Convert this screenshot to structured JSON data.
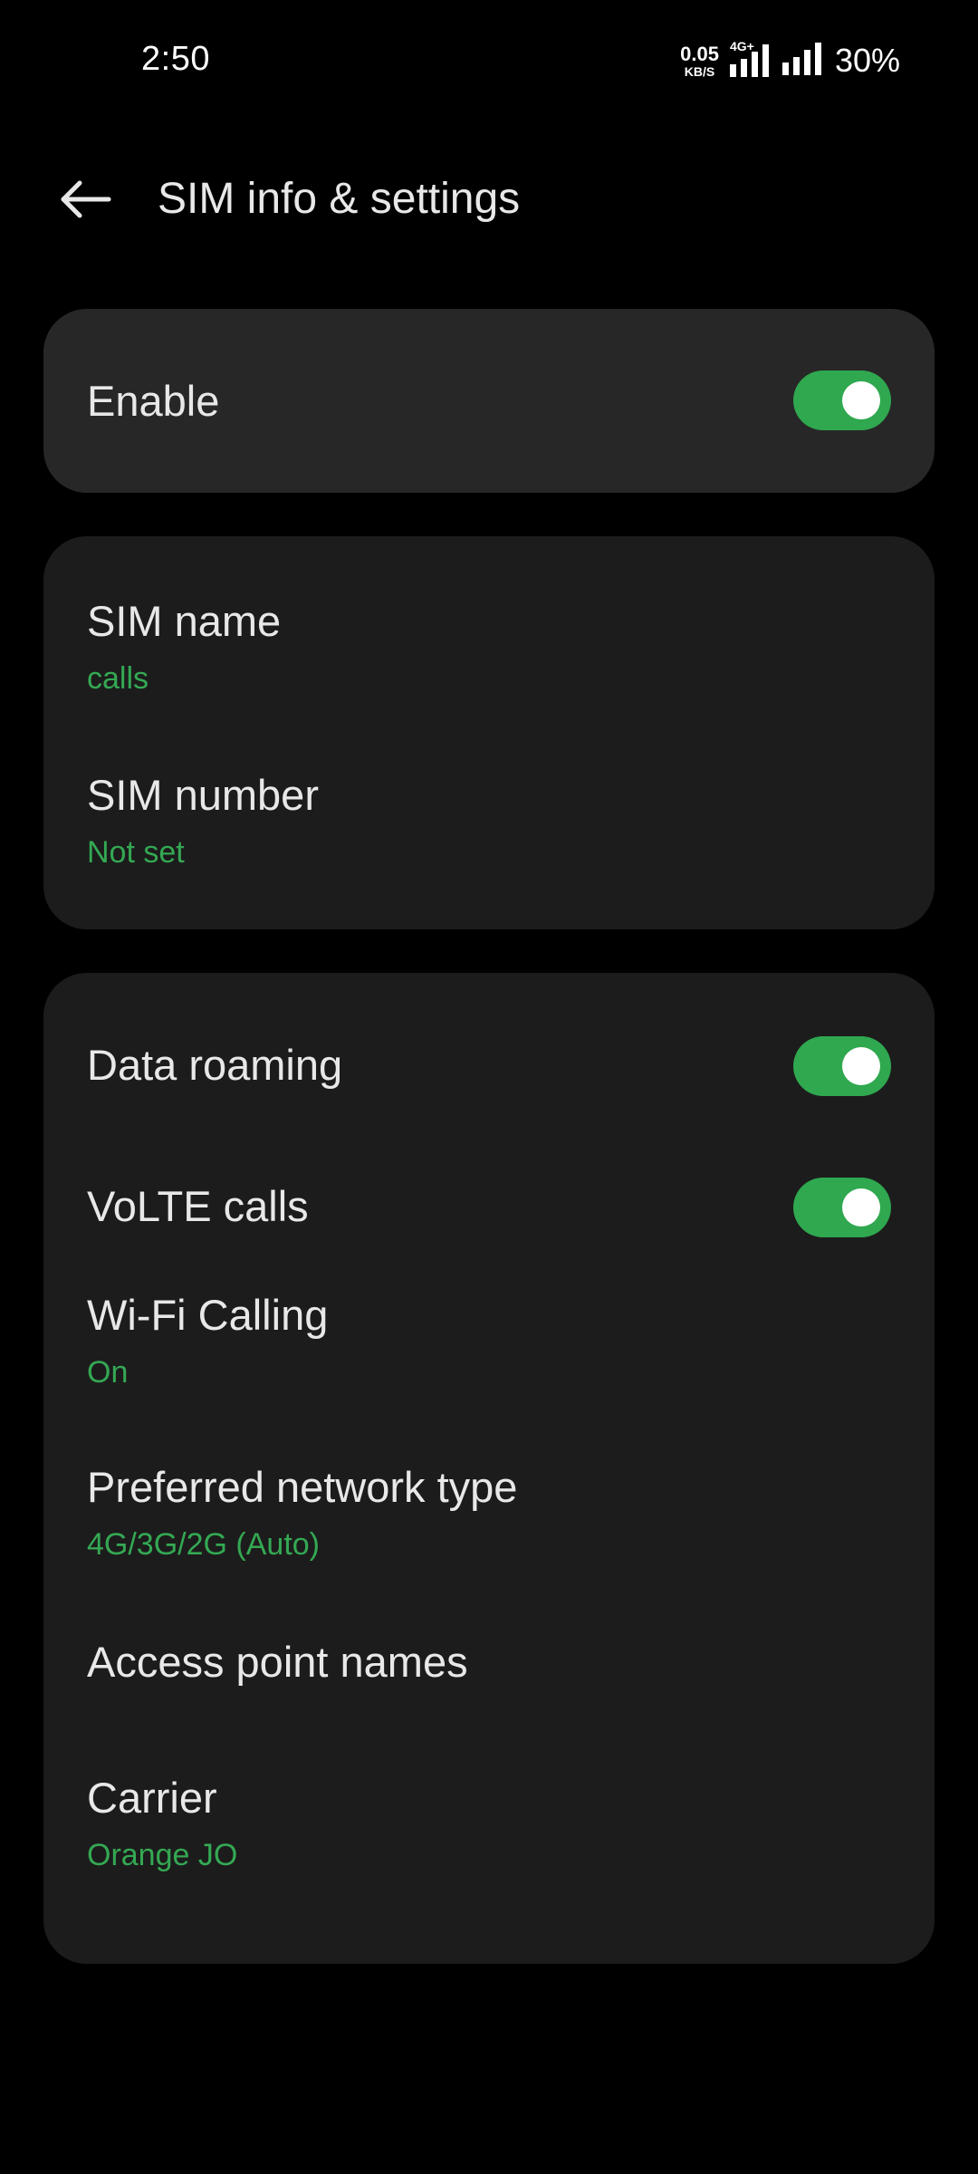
{
  "status_bar": {
    "time": "2:50",
    "net_speed_value": "0.05",
    "net_speed_unit": "KB/S",
    "network_label": "4G+",
    "battery": "30%"
  },
  "header": {
    "title": "SIM info & settings",
    "back_icon": "arrow-left-icon"
  },
  "enable": {
    "label": "Enable",
    "on": true
  },
  "sim": {
    "name_label": "SIM name",
    "name_value": "calls",
    "number_label": "SIM number",
    "number_value": "Not set"
  },
  "network": {
    "data_roaming": {
      "label": "Data roaming",
      "on": true
    },
    "volte": {
      "label": "VoLTE calls",
      "on": true
    },
    "wifi_calling": {
      "label": "Wi-Fi Calling",
      "value": "On"
    },
    "preferred_network": {
      "label": "Preferred network type",
      "value": "4G/3G/2G (Auto)"
    },
    "apn": {
      "label": "Access point names"
    },
    "carrier": {
      "label": "Carrier",
      "value": "Orange JO"
    }
  },
  "colors": {
    "accent": "#34a853",
    "toggle_on": "#2fa84f",
    "background": "#000000",
    "card": "#1c1c1c",
    "card_highlight": "#272727"
  }
}
